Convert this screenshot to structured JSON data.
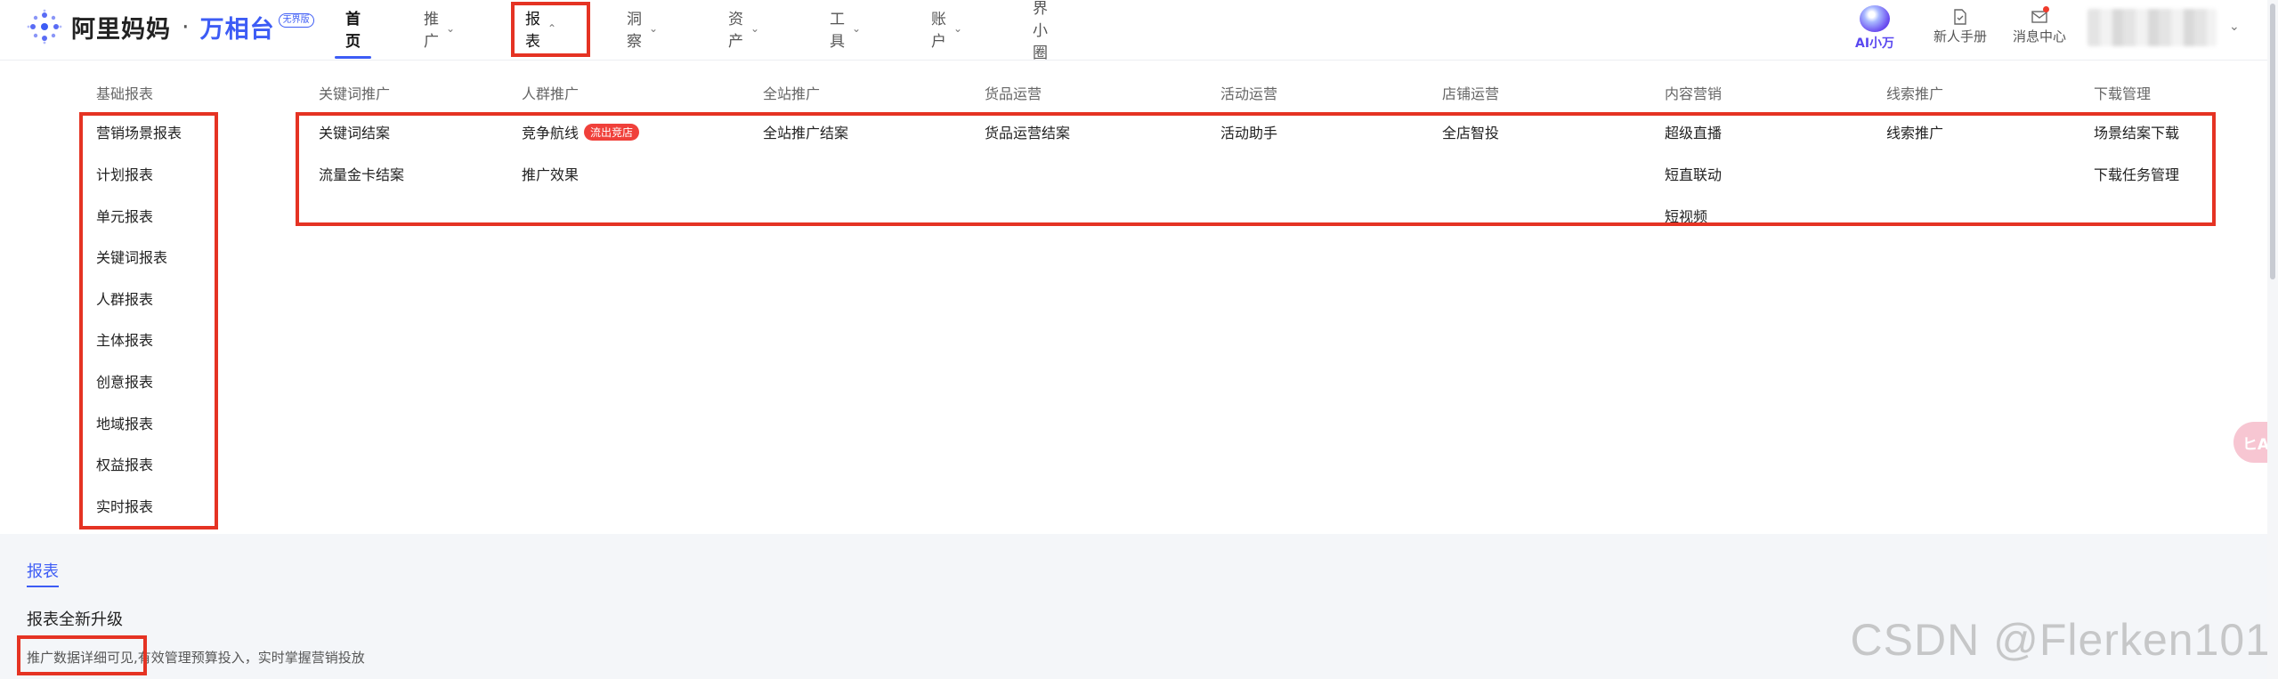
{
  "brand": {
    "name": "阿里妈妈",
    "separator": "·",
    "product": "万相台",
    "badge": "无界版"
  },
  "nav": {
    "items": [
      {
        "label": "首页",
        "chevron": ""
      },
      {
        "label": "推广",
        "chevron": "⌄"
      },
      {
        "label": "报表",
        "chevron": "⌃"
      },
      {
        "label": "洞察",
        "chevron": "⌄"
      },
      {
        "label": "资产",
        "chevron": "⌄"
      },
      {
        "label": "工具",
        "chevron": "⌄"
      },
      {
        "label": "账户",
        "chevron": "⌄"
      },
      {
        "label": "界小圈",
        "chevron": ""
      }
    ],
    "active_index": 0,
    "open_index": 2
  },
  "header_tools": {
    "ai_label": "AI小万",
    "manual_label": "新人手册",
    "manual_icon": "document-icon",
    "message_label": "消息中心",
    "message_icon": "mail-icon",
    "user_chevron": "⌄"
  },
  "dropdown": {
    "columns": [
      {
        "header": "基础报表",
        "items": [
          "营销场景报表",
          "计划报表",
          "单元报表",
          "关键词报表",
          "人群报表",
          "主体报表",
          "创意报表",
          "地域报表",
          "权益报表",
          "实时报表"
        ]
      },
      {
        "header": "关键词推广",
        "items": [
          "关键词结案",
          "流量金卡结案"
        ]
      },
      {
        "header": "人群推广",
        "items": [
          "竞争航线",
          "推广效果"
        ],
        "tag": "流出竞店"
      },
      {
        "header": "全站推广",
        "items": [
          "全站推广结案"
        ]
      },
      {
        "header": "货品运营",
        "items": [
          "货品运营结案"
        ]
      },
      {
        "header": "活动运营",
        "items": [
          "活动助手"
        ]
      },
      {
        "header": "店铺运营",
        "items": [
          "全店智投"
        ]
      },
      {
        "header": "内容营销",
        "items": [
          "超级直播",
          "短直联动",
          "短视频"
        ]
      },
      {
        "header": "线索推广",
        "items": [
          "线索推广"
        ]
      },
      {
        "header": "下载管理",
        "items": [
          "场景结案下载",
          "下载任务管理"
        ]
      }
    ]
  },
  "page": {
    "tab": "报表",
    "title": "报表全新升级",
    "desc_highlight": "推广数据详细可见,",
    "desc_rest": "有效管理预算投入，实时掌握营销投放"
  },
  "float_button": {
    "label": "ヒA",
    "icon": "translate-icon"
  },
  "watermark": "CSDN @Flerken101",
  "colors": {
    "accent": "#3d5cf5",
    "highlight_box": "#e53323",
    "tag": "#f0403a"
  }
}
